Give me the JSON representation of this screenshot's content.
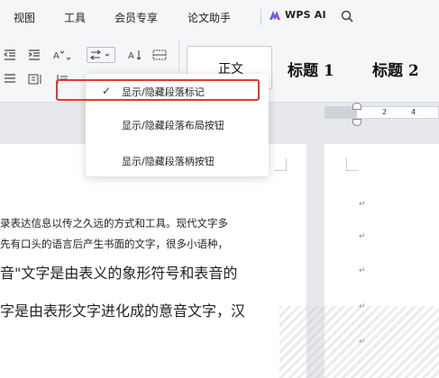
{
  "menubar": {
    "items": [
      "视图",
      "工具",
      "会员专享",
      "论文助手"
    ],
    "wps_ai": "WPS AI",
    "search_icon": "search-icon"
  },
  "ribbon": {
    "style_normal": "正文",
    "style_heading1": "标题  1",
    "style_heading2": "标题  2"
  },
  "ruler": {
    "ticks": [
      "2",
      "4"
    ]
  },
  "dropdown": {
    "items": [
      {
        "label": "显示/隐藏段落标记",
        "checked": true
      },
      {
        "label": "显示/隐藏段落布局按钮",
        "checked": false
      },
      {
        "label": "显示/隐藏段落柄按钮",
        "checked": false
      }
    ],
    "check_mark": "✓",
    "highlight_color": "#e03a2d"
  },
  "document": {
    "lines": [
      "录表达信息以传之久远的方式和工具。现代文字多",
      "先有口头的语言后产生书面的文字，很多小语种，",
      "音\"文字是由表义的象形符号和表音的",
      "字是由表形文字进化成的意音文字，汉"
    ],
    "paragraph_mark": "↵"
  },
  "colors": {
    "accent": "#3d6fe8",
    "wps_ai_gradient": [
      "#3d6fe8",
      "#b23fe0"
    ]
  }
}
